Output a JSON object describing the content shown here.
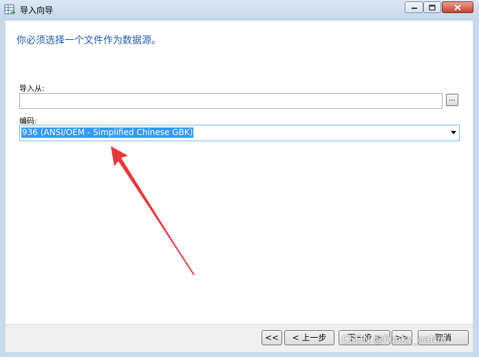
{
  "window": {
    "title": "导入向导"
  },
  "main": {
    "heading": "你必须选择一个文件作为数据源。",
    "import_from": {
      "label": "导入从:",
      "value": "",
      "browse_label": "..."
    },
    "encoding": {
      "label": "编码:",
      "selected_value": "936 (ANSI/OEM - Simplified Chinese GBK)"
    }
  },
  "footer": {
    "first_label": "<<",
    "prev_label": "< 上一步",
    "next_label": "下一步 >",
    "last_label": ">>",
    "cancel_label": "取消"
  },
  "watermark": "CSDN @Funky_oaNiu",
  "colors": {
    "heading": "#1e5aa8",
    "selection": "#3399ff",
    "annotation_arrow": "#e8383d"
  }
}
